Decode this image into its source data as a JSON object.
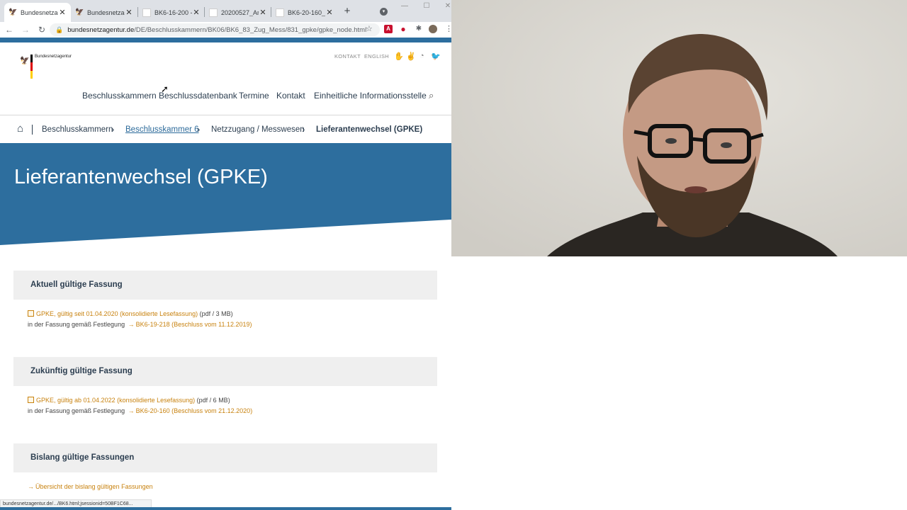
{
  "browser": {
    "tabs": [
      {
        "title": "Bundesnetzag",
        "active": true
      },
      {
        "title": "Bundesnetzag",
        "active": false
      },
      {
        "title": "BK6-16-200 -",
        "active": false
      },
      {
        "title": "20200527_Anl",
        "active": false
      },
      {
        "title": "BK6-20-160_g",
        "active": false
      }
    ],
    "new_tab_label": "+",
    "url_host": "bundesnetzagentur.de",
    "url_path": "/DE/Beschlusskammern/BK06/BK6_83_Zug_Mess/831_gpke/gpke_node.html"
  },
  "site": {
    "logo_text": "Bundesnetzagentur",
    "utility_links": [
      "KONTAKT",
      "ENGLISH"
    ],
    "main_nav": [
      "Beschlusskammern",
      "Beschlussdatenbank",
      "Termine",
      "Kontakt",
      "Einheitliche Informationsstelle"
    ]
  },
  "breadcrumb": {
    "items": [
      "Beschlusskammern",
      "Beschlusskammer 6",
      "Netzzugang / Messwesen",
      "Lieferantenwechsel (GPKE)"
    ]
  },
  "hero": {
    "title": "Lieferantenwechsel (GPKE)",
    "color": "#2d6e9e"
  },
  "sections": [
    {
      "heading": "Aktuell gültige Fassung",
      "doc_link": "GPKE, gültig seit 01.04.2020 (konsolidierte Lesefassung)",
      "doc_meta": "(pdf / 3 MB)",
      "basis_text": "in der Fassung gemäß Festlegung",
      "basis_link": "BK6-19-218 (Beschluss vom 11.12.2019)"
    },
    {
      "heading": "Zukünftig gültige Fassung",
      "doc_link": "GPKE, gültig ab 01.04.2022 (konsolidierte Lesefassung)",
      "doc_meta": "(pdf / 6 MB)",
      "basis_text": "in der Fassung gemäß Festlegung",
      "basis_link": "BK6-20-160 (Beschluss vom 21.12.2020)"
    },
    {
      "heading": "Bislang gültige Fassungen",
      "overview_link": "Übersicht der bislang gültigen Fassungen"
    }
  ],
  "status_bar": "bundesnetzagentur.de/.../BK6.html;jsessionid=50BF1C68..."
}
